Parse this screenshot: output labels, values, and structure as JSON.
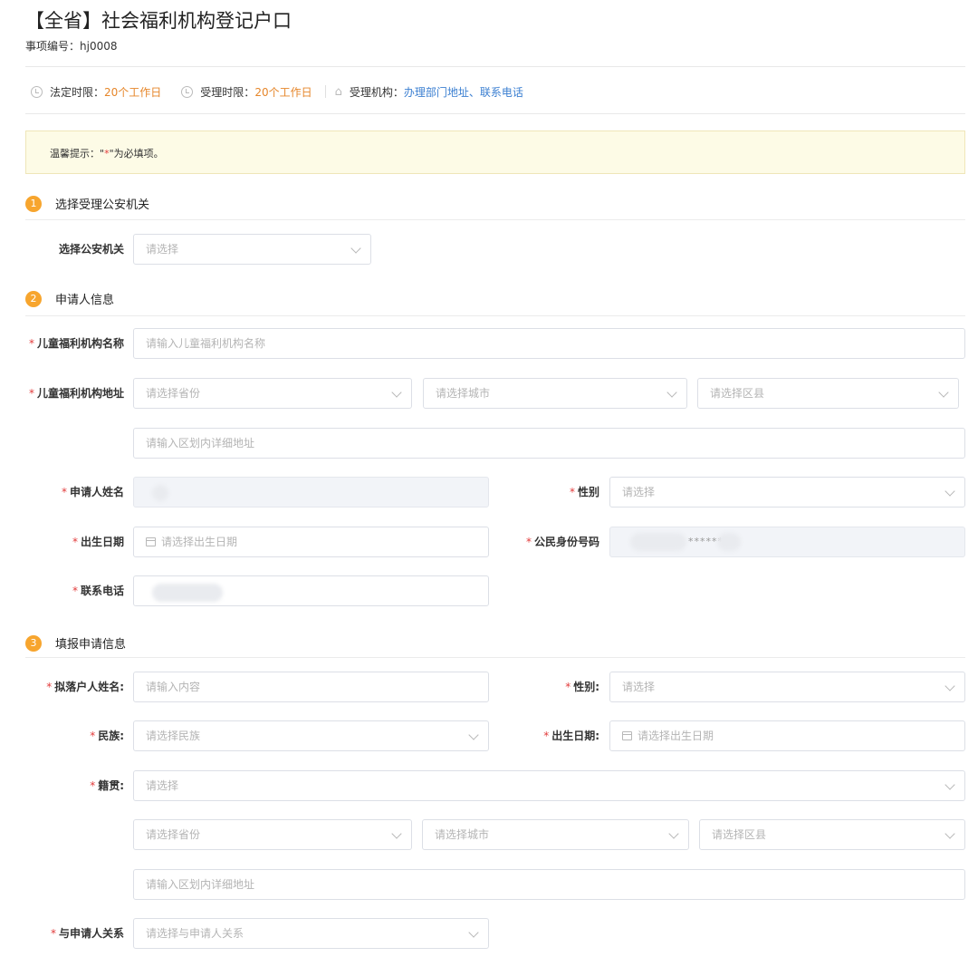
{
  "header": {
    "title": "【全省】社会福利机构登记户口",
    "item_code": "事项编号：hj0008"
  },
  "info_bar": {
    "legal_limit_label": "法定时限：",
    "legal_limit_value": "20个工作日",
    "accept_limit_label": "受理时限：",
    "accept_limit_value": "20个工作日",
    "agency_label": "受理机构：",
    "agency_link": "办理部门地址、联系电话"
  },
  "notice": {
    "prefix": "温馨提示：",
    "quote_open": "\"",
    "asterisk": "*",
    "rest": "\"为必填项。"
  },
  "sections": {
    "s1": {
      "num": "1",
      "title": "选择受理公安机关"
    },
    "s2": {
      "num": "2",
      "title": "申请人信息"
    },
    "s3": {
      "num": "3",
      "title": "填报申请信息"
    }
  },
  "req_mark": "*",
  "police": {
    "label": "选择公安机关",
    "placeholder": "请选择"
  },
  "applicant": {
    "org_name_label": "儿童福利机构名称",
    "org_name_placeholder": "请输入儿童福利机构名称",
    "org_addr_label": "儿童福利机构地址",
    "province_placeholder": "请选择省份",
    "city_placeholder": "请选择城市",
    "district_placeholder": "请选择区县",
    "detail_placeholder": "请输入区划内详细地址",
    "name_label": "申请人姓名",
    "gender_label": "性别",
    "gender_placeholder": "请选择",
    "birth_label": "出生日期",
    "birth_placeholder": "请选择出生日期",
    "id_label": "公民身份号码",
    "id_masked": "******",
    "phone_label": "联系电话"
  },
  "registration": {
    "name_label": "拟落户人姓名:",
    "name_placeholder": "请输入内容",
    "gender_label": "性别:",
    "gender_placeholder": "请选择",
    "ethnic_label": "民族:",
    "ethnic_placeholder": "请选择民族",
    "birth_label": "出生日期:",
    "birth_placeholder": "请选择出生日期",
    "native_label": "籍贯:",
    "native_placeholder": "请选择",
    "province_placeholder": "请选择省份",
    "city_placeholder": "请选择城市",
    "district_placeholder": "请选择区县",
    "detail_placeholder": "请输入区划内详细地址",
    "relation_label": "与申请人关系",
    "relation_placeholder": "请选择与申请人关系"
  }
}
